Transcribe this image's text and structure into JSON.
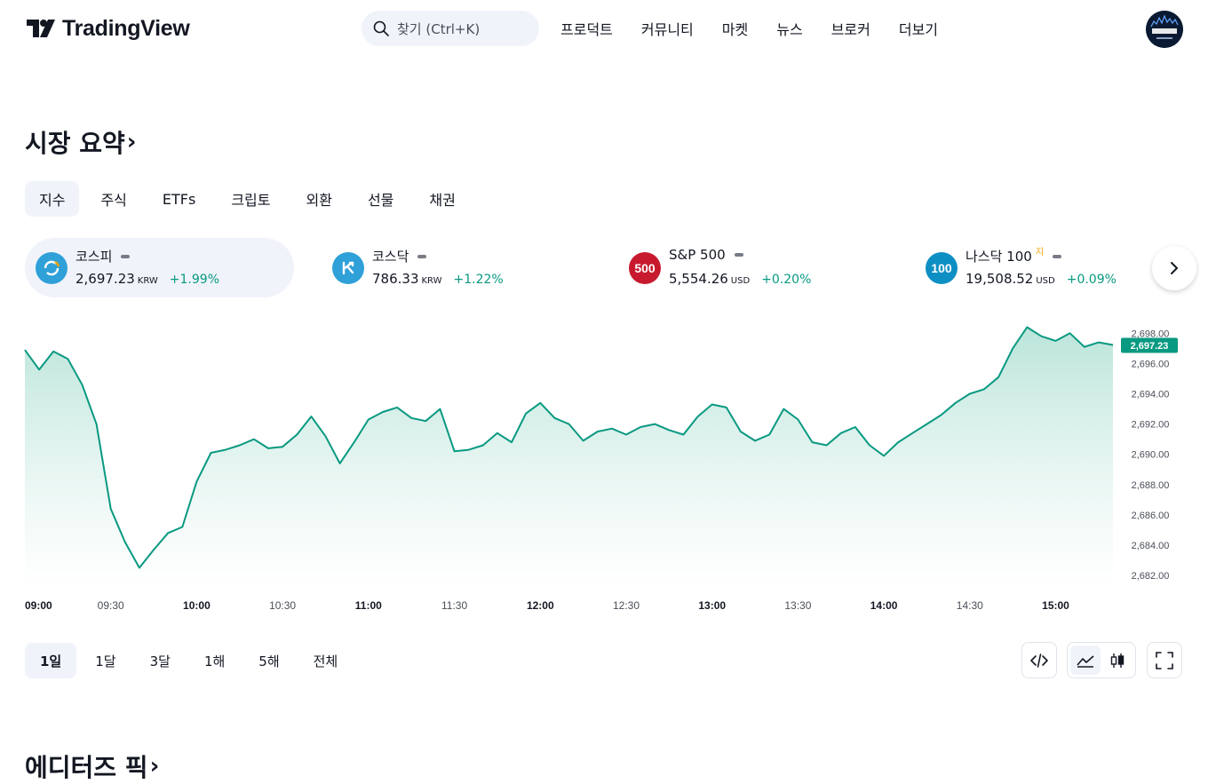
{
  "header": {
    "logo_text": "TradingView",
    "search_placeholder": "찾기 (Ctrl+K)",
    "nav": [
      "프로덕트",
      "커뮤니티",
      "마켓",
      "뉴스",
      "브로커",
      "더보기"
    ]
  },
  "market_summary": {
    "title": "시장 요약",
    "tabs": [
      "지수",
      "주식",
      "ETFs",
      "크립토",
      "외환",
      "선물",
      "채권"
    ],
    "active_tab": "지수",
    "tickers": [
      {
        "name": "코스피",
        "price": "2,697.23",
        "currency": "KRW",
        "change": "+1.99%",
        "icon_color": "#2fa0d8",
        "active": true
      },
      {
        "name": "코스닥",
        "price": "786.33",
        "currency": "KRW",
        "change": "+1.22%",
        "icon_color": "#2fa0d8"
      },
      {
        "name": "S&P 500",
        "price": "5,554.26",
        "currency": "USD",
        "change": "+0.20%",
        "icon_label": "500",
        "icon_color": "#c71a2f"
      },
      {
        "name": "나스닥 100",
        "sup": "지",
        "price": "19,508.52",
        "currency": "USD",
        "change": "+0.09%",
        "icon_label": "100",
        "icon_color": "#0d8fc4"
      }
    ],
    "ranges": [
      "1일",
      "1달",
      "3달",
      "1해",
      "5해",
      "전체"
    ],
    "active_range": "1일"
  },
  "editors_pick": {
    "title": "에디터즈 픽"
  },
  "colors": {
    "line": "#089981",
    "fill_top": "#b7e3d8",
    "accent_bg": "#f0f3fa",
    "last_price_badge": "#089981"
  },
  "chart_data": {
    "type": "area",
    "xlabel": "",
    "ylabel": "",
    "x_ticks": [
      "09:00",
      "09:30",
      "10:00",
      "10:30",
      "11:00",
      "11:30",
      "12:00",
      "12:30",
      "13:00",
      "13:30",
      "14:00",
      "14:30",
      "15:00"
    ],
    "x_ticks_bold": [
      "09:00",
      "10:00",
      "11:00",
      "12:00",
      "13:00",
      "14:00",
      "15:00"
    ],
    "y_ticks": [
      "2,698.00",
      "2,696.00",
      "2,694.00",
      "2,692.00",
      "2,690.00",
      "2,688.00",
      "2,686.00",
      "2,684.00",
      "2,682.00"
    ],
    "ylim": [
      2681.3,
      2698.9
    ],
    "last_price_label": "2,697.23",
    "series": [
      {
        "x": [
          "09:00",
          "09:05",
          "09:10",
          "09:15",
          "09:20",
          "09:25",
          "09:30",
          "09:35",
          "09:40",
          "09:45",
          "09:50",
          "09:55",
          "10:00",
          "10:05",
          "10:10",
          "10:15",
          "10:20",
          "10:25",
          "10:30",
          "10:35",
          "10:40",
          "10:45",
          "10:50",
          "10:55",
          "11:00",
          "11:05",
          "11:10",
          "11:15",
          "11:20",
          "11:25",
          "11:30",
          "11:35",
          "11:40",
          "11:45",
          "11:50",
          "11:55",
          "12:00",
          "12:05",
          "12:10",
          "12:15",
          "12:20",
          "12:25",
          "12:30",
          "12:35",
          "12:40",
          "12:45",
          "12:50",
          "12:55",
          "13:00",
          "13:05",
          "13:10",
          "13:15",
          "13:20",
          "13:25",
          "13:30",
          "13:35",
          "13:40",
          "13:45",
          "13:50",
          "13:55",
          "14:00",
          "14:05",
          "14:10",
          "14:15",
          "14:20",
          "14:25",
          "14:30",
          "14:35",
          "14:40",
          "14:45",
          "14:50",
          "14:55",
          "15:00",
          "15:05",
          "15:10",
          "15:15",
          "15:20"
        ],
        "values": [
          2696.9,
          2695.6,
          2696.8,
          2696.3,
          2694.6,
          2692.0,
          2686.4,
          2684.2,
          2682.5,
          2683.7,
          2684.8,
          2685.2,
          2688.2,
          2690.1,
          2690.3,
          2690.6,
          2691.0,
          2690.4,
          2690.5,
          2691.3,
          2692.5,
          2691.2,
          2689.4,
          2690.8,
          2692.3,
          2692.8,
          2693.1,
          2692.4,
          2692.2,
          2693.0,
          2690.2,
          2690.3,
          2690.6,
          2691.4,
          2690.8,
          2692.7,
          2693.4,
          2692.4,
          2692.0,
          2690.9,
          2691.5,
          2691.7,
          2691.3,
          2691.8,
          2692.0,
          2691.6,
          2691.3,
          2692.5,
          2693.3,
          2693.1,
          2691.5,
          2690.9,
          2691.3,
          2693.0,
          2692.3,
          2690.8,
          2690.6,
          2691.4,
          2691.8,
          2690.6,
          2689.9,
          2690.8,
          2691.4,
          2692.0,
          2692.6,
          2693.4,
          2694.0,
          2694.3,
          2695.1,
          2697.0,
          2698.4,
          2697.8,
          2697.5,
          2698.0,
          2697.1,
          2697.4,
          2697.23
        ]
      }
    ]
  }
}
